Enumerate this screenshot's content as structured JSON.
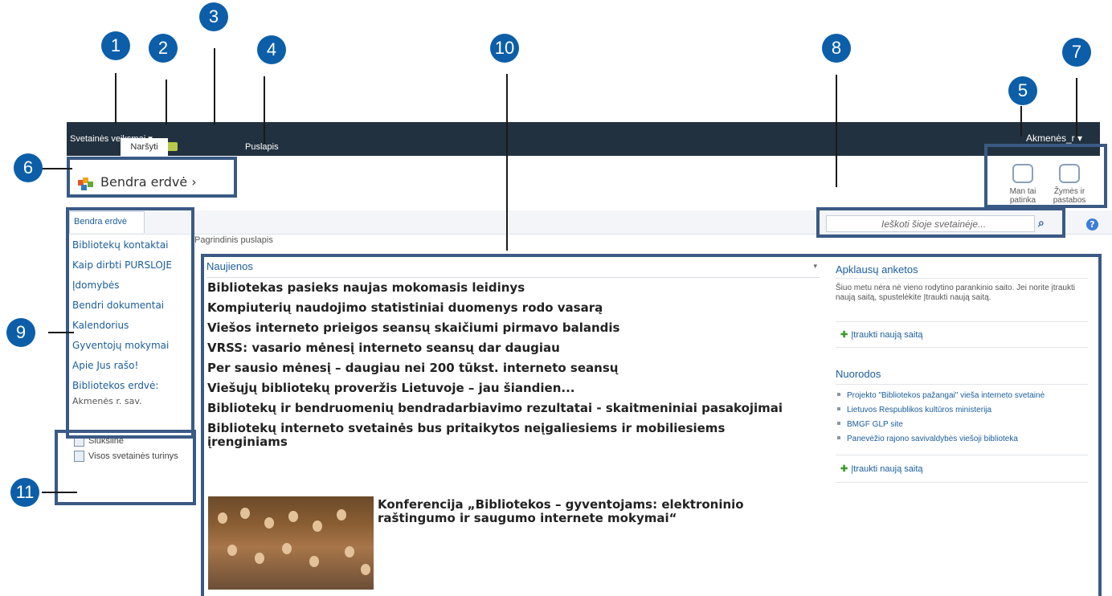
{
  "topbar": {
    "site_actions": "Svetainės veiksmai ▾",
    "tab_browse": "Naršyti",
    "tab_page": "Puslapis",
    "user": "Akmenės_r ▾"
  },
  "site": {
    "title": "Bendra erdvė ›"
  },
  "social": {
    "like_label": "Man tai patinka",
    "tags_label": "Žymės ir pastabos"
  },
  "search": {
    "placeholder": "Ieškoti šioje svetainėje..."
  },
  "help": "?",
  "breadcrumb": "Pagrindinis puslapis",
  "leftnav": {
    "header": "Bendra erdvė",
    "items": [
      "Bibliotekų kontaktai",
      "Kaip dirbti PURSLOJE",
      "Įdomybės",
      "Bendri dokumentai",
      "Kalendorius",
      "Gyventojų mokymai",
      "Apie Jus rašo!",
      "Bibliotekos erdvė:"
    ],
    "sub_item": "Akmenės r. sav.",
    "recycle": "Šiukšlinė",
    "all_content": "Visos svetainės turinys"
  },
  "news": {
    "header": "Naujienos",
    "caret": "▾",
    "items": [
      "Bibliotekas pasieks naujas mokomasis leidinys",
      "Kompiuterių naudojimo statistiniai duomenys rodo vasarą",
      "Viešos interneto prieigos seansų skaičiumi pirmavo balandis",
      "VRSS: vasario mėnesį interneto seansų dar daugiau",
      "Per sausio mėnesį – daugiau nei 200 tūkst. interneto seansų",
      "Viešųjų bibliotekų proveržis Lietuvoje – jau šiandien...",
      "Bibliotekų ir bendruomenių bendradarbiavimo rezultatai - skaitmeniniai pasakojimai",
      "Bibliotekų interneto svetainės bus pritaikytos neįgaliesiems ir mobiliesiems įrenginiams"
    ],
    "feature": "Konferencija „Bibliotekos – gyventojams: elektroninio raštingumo ir saugumo internete mokymai“"
  },
  "surveys": {
    "header": "Apklausų anketos",
    "text": "Šiuo metu nėra nė vieno rodytino parankinio saito. Jei norite įtraukti naują saitą, spustelėkite Įtraukti naują saitą.",
    "add": "Įtraukti naują saitą"
  },
  "links": {
    "header": "Nuorodos",
    "items": [
      "Projekto \"Bibliotekos pažangai\" vieša interneto svetainė",
      "Lietuvos Respublikos kultūros ministerija",
      "BMGF GLP site",
      "Panevėžio rajono savivaldybės viešoji biblioteka"
    ],
    "add": "Įtraukti naują saitą"
  },
  "callouts": [
    "1",
    "2",
    "3",
    "4",
    "5",
    "6",
    "7",
    "8",
    "9",
    "10",
    "11"
  ],
  "colors": {
    "topbar": "#22313f",
    "link": "#1b5d9c",
    "callout": "#0c5ea8",
    "frame": "#3a5a85"
  }
}
